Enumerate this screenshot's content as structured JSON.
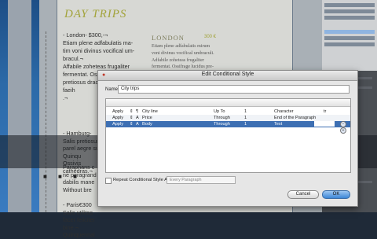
{
  "document": {
    "title": "DAY TRIPS",
    "column1_block1": "- London-      $300,-¬\nEtiam plene adfabulatis ma-\ntim voni divinus vocifical um-\nbracul.¬\nAffabile zoheteas frugaliter\nfermentat. Ossifrage lucidus\npretiosus dracorensis prosti.\nfaeih\n.¬",
    "column1_block2": "- Hamburg-\nSalis pretiosus\nparel aegre su\nQuinqu\nOssivis\ncathedras.¬",
    "column1_block3": "Paraphans c\nne peragrand\ndabilis mane\nWithout bre\n\n- Paris€300\nSalis utilitas\nfacer feliciter\nbine.¬\nQuinquennal",
    "column2_heading": "LONDON",
    "column2_price": "300 €",
    "column2_text": "Etiam plene adfabulatis mirum\nvoni divinus vocifical umbraculi.\nAdfabile zoheteas frugaliter\nfermentat. Ossifrage lucidus pre-\ntiosus dracorensis prosti. faeih."
  },
  "dialog": {
    "title": "Edit Conditional Style",
    "name_label": "Name:",
    "name_value": "City trips",
    "rows": [
      {
        "apply": "Apply",
        "field": "City line",
        "operator": "Up To",
        "value": "1",
        "context": "Character",
        "format": "tr"
      },
      {
        "apply": "Apply",
        "field": "Price",
        "operator": "Through",
        "value": "1",
        "context": "End of the Paragraph",
        "format": ""
      },
      {
        "apply": "Apply",
        "field": "Body",
        "operator": "Through",
        "value": "1",
        "context": "Text",
        "format": ""
      }
    ],
    "repeat_label": "Repeat Conditional Style At:",
    "repeat_select": "Every Paragraph",
    "cancel_label": "Cancel",
    "ok_label": "OK"
  },
  "icons": {
    "app_icon": "app-icon",
    "field_icon": "paragraph-style-icon",
    "add": "add-row-icon",
    "remove": "remove-row-icon"
  },
  "colors": {
    "accent": "#3d6fb3",
    "title_olive": "#a2a33a"
  }
}
